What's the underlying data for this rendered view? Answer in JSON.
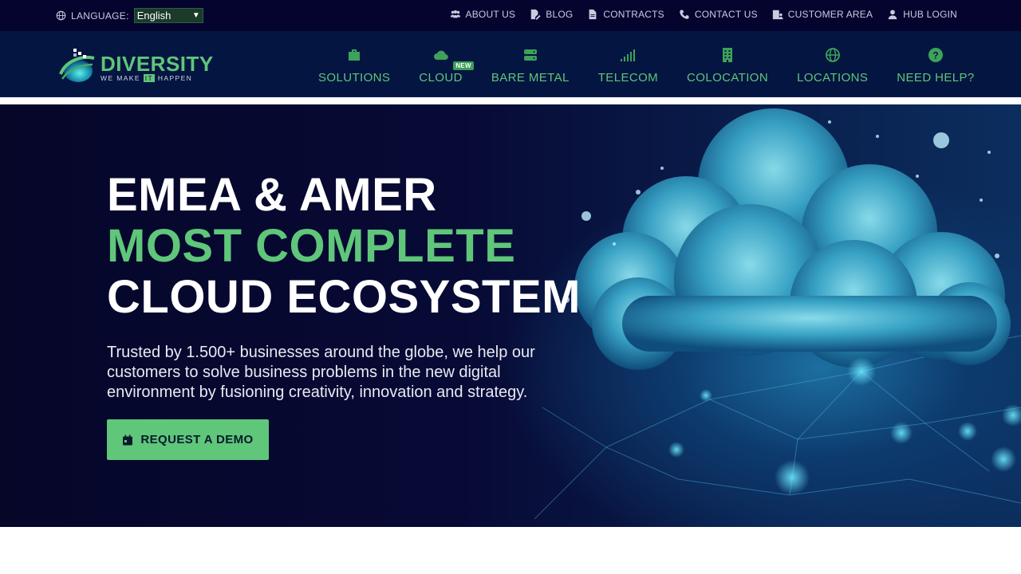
{
  "topbar": {
    "language_label": "LANGUAGE:",
    "language_value": "English",
    "links": [
      {
        "label": "ABOUT US",
        "icon": "users-icon"
      },
      {
        "label": "BLOG",
        "icon": "blog-edit-icon"
      },
      {
        "label": "CONTRACTS",
        "icon": "document-icon"
      },
      {
        "label": "CONTACT US",
        "icon": "phone-icon"
      },
      {
        "label": "CUSTOMER AREA",
        "icon": "building-user-icon"
      },
      {
        "label": "HUB LOGIN",
        "icon": "user-icon"
      }
    ]
  },
  "brand": {
    "name": "DIVERSITY",
    "tagline_pre": "WE MAKE ",
    "tagline_it": "IT",
    "tagline_post": " HAPPEN"
  },
  "nav": {
    "items": [
      {
        "label": "SOLUTIONS",
        "icon": "briefcase-icon"
      },
      {
        "label": "CLOUD",
        "icon": "cloud-icon",
        "badge": "NEW"
      },
      {
        "label": "BARE METAL",
        "icon": "server-icon"
      },
      {
        "label": "TELECOM",
        "icon": "signal-icon"
      },
      {
        "label": "COLOCATION",
        "icon": "building-icon"
      },
      {
        "label": "LOCATIONS",
        "icon": "globe-icon"
      },
      {
        "label": "NEED HELP?",
        "icon": "question-icon"
      }
    ]
  },
  "hero": {
    "line1": "EMEA & AMER",
    "line2": "MOST COMPLETE",
    "line3": "CLOUD ECOSYSTEM",
    "text": "Trusted by 1.500+ businesses around the globe, we help our customers to solve business problems in the new digital environment by fusioning creativity, innovation and strategy.",
    "cta": "REQUEST A DEMO"
  },
  "colors": {
    "accent": "#5fc67a",
    "topbar_bg": "#04042e",
    "nav_bg": "#051541",
    "hero_bg": "#060629"
  }
}
